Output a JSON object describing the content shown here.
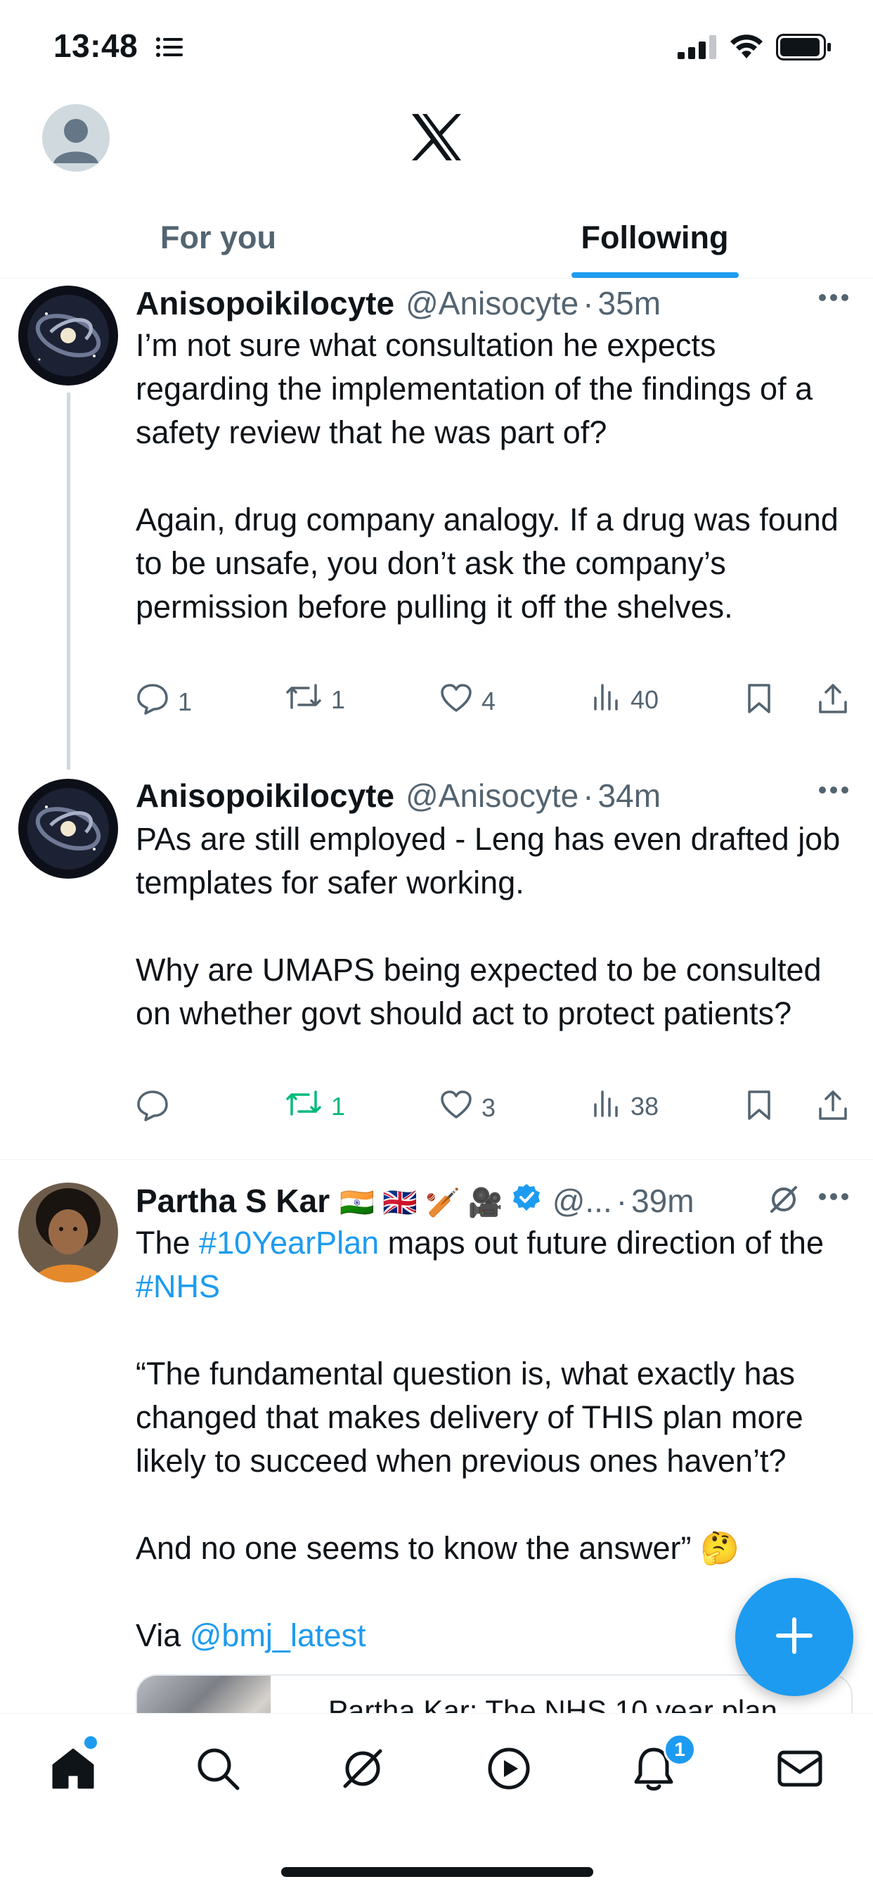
{
  "status_bar": {
    "time": "13:48"
  },
  "header": {
    "logo": "x-logo",
    "tabs": [
      {
        "label": "For you",
        "active": false
      },
      {
        "label": "Following",
        "active": true
      }
    ]
  },
  "tweets": [
    {
      "name": "Anisopoikilocyte",
      "handle": "@Anisocyte",
      "sep": "·",
      "time": "35m",
      "paragraphs": [
        "I’m not sure what consultation he expects regarding the implementation of the findings of a safety review that he was part of?",
        "Again, drug company analogy. If a drug was found to be unsafe, you don’t ask the company’s permission before pulling it off the shelves."
      ],
      "replies": "1",
      "reposts": "1",
      "likes": "4",
      "views": "40"
    },
    {
      "name": "Anisopoikilocyte",
      "handle": "@Anisocyte",
      "sep": "·",
      "time": "34m",
      "paragraphs": [
        "PAs are still employed - Leng has even drafted job templates for safer working.",
        "Why are UMAPS being expected to be consulted on whether govt should act to protect patients?"
      ],
      "replies": "",
      "reposts": "1",
      "likes": "3",
      "views": "38"
    },
    {
      "name": "Partha S Kar",
      "name_emojis": "🇮🇳 🇬🇧 🏏 🎥",
      "handle": "@...",
      "sep": "·",
      "time": "39m",
      "text_line1_pre": "The ",
      "hashtag1": "#10YearPlan",
      "text_line1_post": " maps out future direction of the ",
      "hashtag2": "#NHS",
      "quote": "“The fundamental question is, what exactly has changed that makes delivery of THIS plan more likely to succeed when previous ones haven’t?",
      "quote_end": "And no one seems to know the answer” ",
      "thinking_emoji": "🤔",
      "via_prefix": "Via ",
      "via_mention": "@bmj_latest",
      "card_title": "Partha Kar: The NHS 10 year plan"
    }
  ],
  "bottom_nav": {
    "items": [
      "home-icon",
      "search-icon",
      "grok-icon",
      "video-icon",
      "notifications-icon",
      "messages-icon"
    ],
    "notifications_badge": "1"
  },
  "colors": {
    "accent": "#1d9bf0",
    "repost_green": "#00ba7c",
    "secondary_text": "#536471"
  }
}
